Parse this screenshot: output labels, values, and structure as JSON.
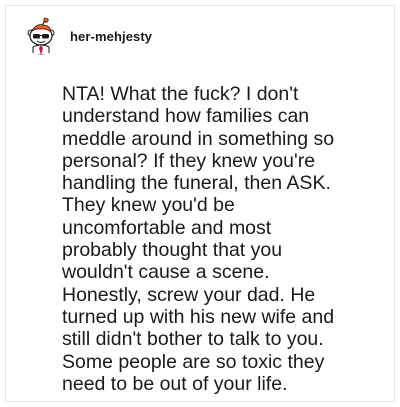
{
  "post": {
    "username": "her-mehjesty",
    "avatar_icon": "snoo-avatar-with-sunglasses-icon",
    "comment_text": "NTA! What the fuck? I don't\nunderstand how families can\nmeddle around in something so\npersonal? If they knew you're\nhandling the funeral, then ASK.\nThey knew you'd be\nuncomfortable and most\nprobably thought that you\nwouldn't cause a scene.\nHonestly, screw your dad. He\nturned up with his new wife and\nstill didn't bother to talk to you.\nSome people are so toxic they\nneed to be out of your life."
  },
  "colors": {
    "text": "#1a1a1b",
    "border": "#e6e6e6",
    "avatar_orange": "#ff5a1f"
  }
}
